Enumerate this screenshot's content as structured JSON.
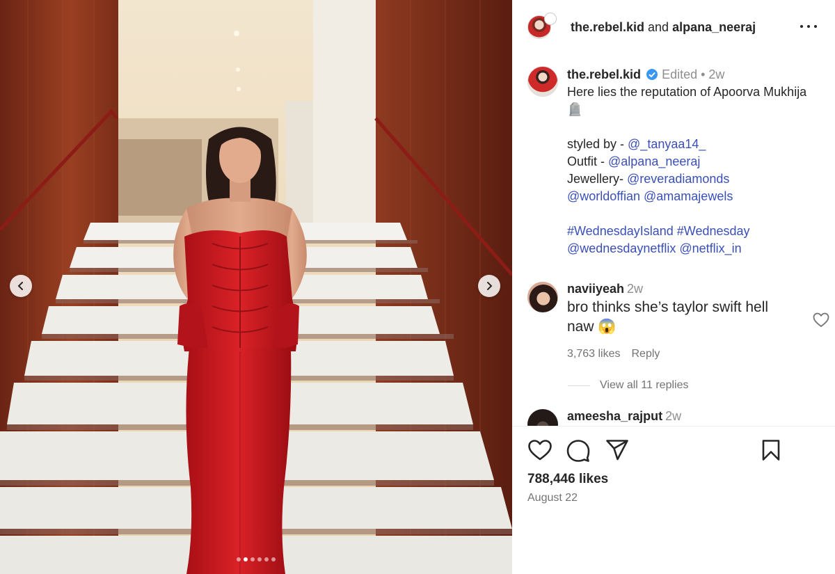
{
  "header": {
    "user1": "the.rebel.kid",
    "and": " and ",
    "user2": "alpana_neeraj"
  },
  "caption": {
    "username": "the.rebel.kid",
    "edited": "Edited",
    "sep": " • ",
    "time": "2w",
    "line1": "Here lies the reputation of Apoorva Mukhija 🪦",
    "styled_label": "styled by - ",
    "styled_link": "@_tanyaa14_",
    "outfit_label": "Outfit - ",
    "outfit_link": "@alpana_neeraj",
    "jewellery_label": "Jewellery- ",
    "jewellery_link1": "@reveradiamonds",
    "jewellery_link2": "@worldoffian",
    "jewellery_link3": "@amamajewels",
    "tag1": "#WednesdayIsland",
    "tag2": "#Wednesday",
    "tag3": "@wednesdaynetflix",
    "tag4": "@netflix_in"
  },
  "comments": [
    {
      "username": "naviiyeah",
      "time": "2w",
      "text": "bro thinks she’s taylor swift hell naw 😱",
      "likes": "3,763 likes",
      "reply": "Reply",
      "view_replies": "View all 11 replies"
    },
    {
      "username": "ameesha_rajput",
      "time": "2w"
    }
  ],
  "footer": {
    "likes": "788,446 likes",
    "date": "August 22"
  },
  "carousel": {
    "slides": 6,
    "active_index": 1
  },
  "colors": {
    "link": "#3a4fb8",
    "verified": "#3897f0",
    "gown": "#c8161c"
  },
  "icons": [
    "chevron-left-icon",
    "chevron-right-icon",
    "more-icon",
    "verified-icon",
    "heart-icon",
    "comment-icon",
    "share-icon",
    "bookmark-icon"
  ]
}
